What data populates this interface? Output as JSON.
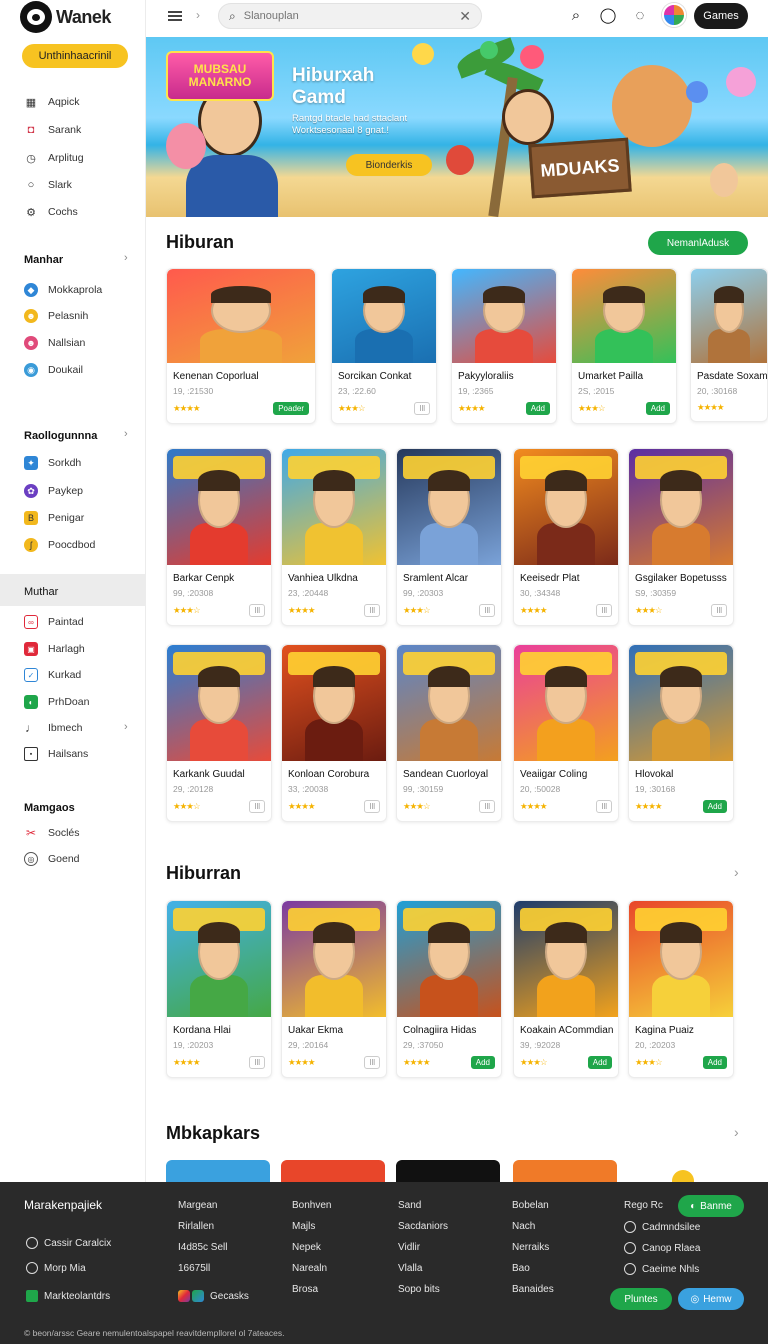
{
  "app": {
    "name": "Wanek"
  },
  "sidebar": {
    "cta_label": "Unthinhaacrinil",
    "items_top": [
      {
        "label": "Aqpick",
        "icon": "app-grid-icon"
      },
      {
        "label": "Sarank",
        "icon": "bookmark-icon"
      },
      {
        "label": "Arplitug",
        "icon": "clock-icon"
      },
      {
        "label": "Slark",
        "icon": "bulb-icon"
      },
      {
        "label": "Cochs",
        "icon": "gear-icon"
      }
    ],
    "section1": {
      "title": "Manhar",
      "items": [
        {
          "label": "Mokkaprola",
          "color": "#2f86d6"
        },
        {
          "label": "Pelasnih",
          "color": "#f2b81d"
        },
        {
          "label": "Nallsian",
          "color": "#e04a7a"
        },
        {
          "label": "Doukail",
          "color": "#3a9bd8"
        }
      ]
    },
    "section2": {
      "title": "Raollogunnna",
      "items": [
        {
          "label": "Sorkdh",
          "color": "#2f86d6"
        },
        {
          "label": "Paykep",
          "color": "#6b3fc2"
        },
        {
          "label": "Penigar",
          "color": "#f2b81d"
        },
        {
          "label": "Poocdbod",
          "color": "#f2b81d"
        }
      ]
    },
    "section3": {
      "title": "Muthar",
      "items": [
        {
          "label": "Paintad",
          "color": "#e0293a"
        },
        {
          "label": "Harlagh",
          "color": "#e0293a"
        },
        {
          "label": "Kurkad",
          "color": "#2f86d6"
        },
        {
          "label": "PrhDoan",
          "color": "#1fa64a"
        },
        {
          "label": "Ibmech",
          "color": "#333333"
        },
        {
          "label": "Hailsans",
          "color": "#333333"
        }
      ]
    },
    "section4": {
      "title": "Mamgaos",
      "items": [
        {
          "label": "Soclés",
          "color": "#e0293a"
        },
        {
          "label": "Goend",
          "color": "#555555"
        }
      ]
    }
  },
  "topbar": {
    "search_placeholder": "Slanouplan",
    "games_label": "Games"
  },
  "hero": {
    "logo_text": "MUBSAU MANARNO",
    "title": "Hiburxah Gamd",
    "subtitle": "Rantgd btacle had sttaclant Worktsesonaal 8 gnat.!",
    "button": "Bionderkis",
    "sign": "MDUAKS"
  },
  "sections": [
    {
      "title": "Hiburan",
      "action": "NemanlAdusk"
    },
    {
      "title": "Hiburran"
    },
    {
      "title": "Mbkapkars"
    }
  ],
  "cards_row1": [
    {
      "name": "Kenenan Coporlual",
      "meta": "19, :21530",
      "stars": 4,
      "tag": "Poader",
      "tag_green": true,
      "c1": "#ff5a4d",
      "c2": "#f0a23a"
    },
    {
      "name": "Sorcikan Conkat",
      "meta": "23, :22.60",
      "stars": 3,
      "tag": "Ill",
      "tag_green": false,
      "c1": "#2ea3e0",
      "c2": "#1a6fb1"
    },
    {
      "name": "Pakyyloraliis",
      "meta": "19, :2365",
      "stars": 4,
      "tag": "Add",
      "tag_green": true,
      "c1": "#43b7ff",
      "c2": "#e64b3c"
    },
    {
      "name": "Umarket Pailla",
      "meta": "2S, :2015",
      "stars": 3,
      "tag": "Add",
      "tag_green": true,
      "c1": "#ff8c3a",
      "c2": "#33c159"
    },
    {
      "name": "Pasdate Soxam",
      "meta": "20, :30168",
      "stars": 4,
      "tag": "",
      "tag_green": false,
      "c1": "#8dcfee",
      "c2": "#b0733b"
    }
  ],
  "cards_row2": [
    {
      "name": "Barkar Cenpk",
      "meta": "99, :20308",
      "stars": 3,
      "tag": "Ill",
      "tag_green": false,
      "c1": "#2f7ac9",
      "c2": "#e43b2e"
    },
    {
      "name": "Vanhiea Ulkdna",
      "meta": "23, :20448",
      "stars": 4,
      "tag": "Ill",
      "tag_green": false,
      "c1": "#3fa9e8",
      "c2": "#f0c231"
    },
    {
      "name": "Sramlent Alcar",
      "meta": "99, :20303",
      "stars": 3,
      "tag": "Ill",
      "tag_green": false,
      "c1": "#26395c",
      "c2": "#7aa2d8"
    },
    {
      "name": "Keeisedr Plat",
      "meta": "30, :34348",
      "stars": 4,
      "tag": "Ill",
      "tag_green": false,
      "c1": "#f28b1f",
      "c2": "#7b2a19"
    },
    {
      "name": "Gsgilaker Bopetusss",
      "meta": "S9, :30359",
      "stars": 3,
      "tag": "Ill",
      "tag_green": false,
      "c1": "#5b2ea3",
      "c2": "#d77b2f"
    }
  ],
  "cards_row3": [
    {
      "name": "Karkank Guudal",
      "meta": "29, :20128",
      "stars": 3,
      "tag": "Ill",
      "tag_green": false,
      "c1": "#2a7ed3",
      "c2": "#e74b3a"
    },
    {
      "name": "Konloan Corobura",
      "meta": "33, :20038",
      "stars": 4,
      "tag": "Ill",
      "tag_green": false,
      "c1": "#e2511f",
      "c2": "#6b1c10"
    },
    {
      "name": "Sandean Cuorloyal",
      "meta": "99, :30159",
      "stars": 3,
      "tag": "Ill",
      "tag_green": false,
      "c1": "#5b86c9",
      "c2": "#c77a35"
    },
    {
      "name": "Veaiigar Coling",
      "meta": "20, :50028",
      "stars": 4,
      "tag": "Ill",
      "tag_green": false,
      "c1": "#ea3f9a",
      "c2": "#f3a01e"
    },
    {
      "name": "Hlovokal",
      "meta": "19, :30168",
      "stars": 4,
      "tag": "Add",
      "tag_green": true,
      "c1": "#2f6fb8",
      "c2": "#d99a2f"
    }
  ],
  "cards_row4": [
    {
      "name": "Kordana Hlai",
      "meta": "19, :20203",
      "stars": 4,
      "tag": "Ill",
      "tag_green": false,
      "c1": "#43b0e8",
      "c2": "#45a845"
    },
    {
      "name": "Uakar Ekma",
      "meta": "29, :20164",
      "stars": 4,
      "tag": "Ill",
      "tag_green": false,
      "c1": "#7b3aa1",
      "c2": "#f2bd2c"
    },
    {
      "name": "Colnagiira Hidas",
      "meta": "29, :37050",
      "stars": 4,
      "tag": "Add",
      "tag_green": true,
      "c1": "#1f9fd6",
      "c2": "#c7521c"
    },
    {
      "name": "Koakain ACommdian",
      "meta": "39, :92028",
      "stars": 3,
      "tag": "Add",
      "tag_green": true,
      "c1": "#1e3c6b",
      "c2": "#f2a21c"
    },
    {
      "name": "Kagina Puaiz",
      "meta": "20, :20203",
      "stars": 3,
      "tag": "Add",
      "tag_green": true,
      "c1": "#e8462a",
      "c2": "#f6d03a"
    }
  ],
  "cards_row5_colors": [
    "#3aa1df",
    "#e8462a",
    "#111111",
    "#f07a28"
  ],
  "footer": {
    "brand": "Marakenpajiek",
    "left_links": [
      {
        "label": "Cassir Caralcix",
        "icon": "clock-icon"
      },
      {
        "label": "Morp Mia",
        "icon": "clock-icon"
      },
      {
        "label": "Markteolantdrs",
        "icon": "green-square-icon"
      }
    ],
    "col1": [
      "Margean",
      "Rirlallen",
      "I4d85c Sell",
      "16675ll"
    ],
    "col1_bottom": "Gecasks",
    "col2": [
      "Bonhven",
      "Majls",
      "Nepek",
      "Narealn",
      "Brosa"
    ],
    "col3": [
      "Sand",
      "Sacdaniors",
      "Vidlir",
      "Vlalla",
      "Sopo bits"
    ],
    "col4": [
      "Bobelan",
      "Nach",
      "Nerraiks",
      "Bao",
      "Banaides"
    ],
    "col5_title": "Rego Rc",
    "col5": [
      "Cadmndsilee",
      "Canop Rlaea",
      "Caeime Nhls"
    ],
    "pill_green": "Banme",
    "pill_green2": "Pluntes",
    "pill_blue": "Hemw",
    "copyright": "© beon/arssc Geare nemulentoalspapel reavitdempllorel ol 7ateaces."
  }
}
